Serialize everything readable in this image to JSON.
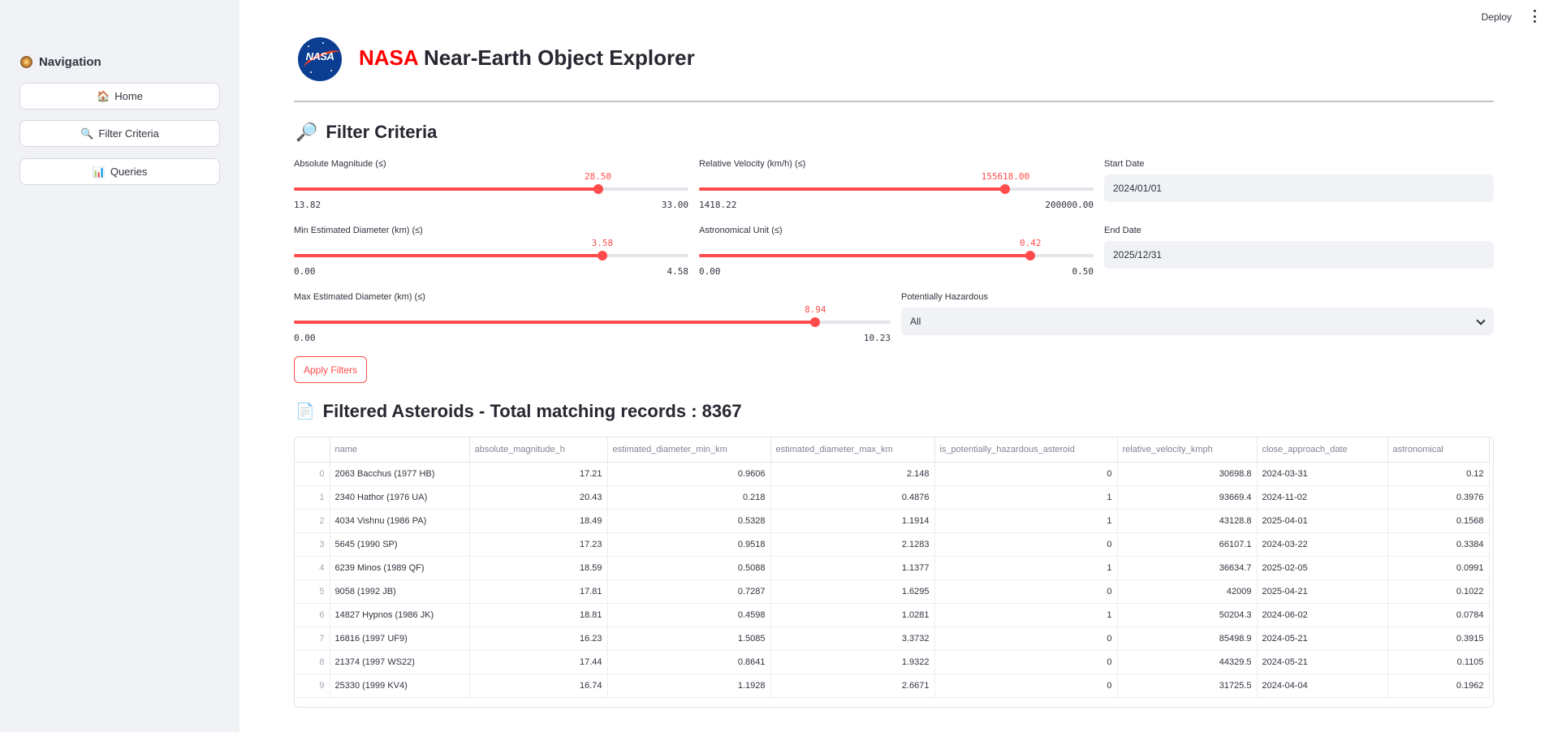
{
  "header": {
    "deploy_label": "Deploy",
    "title_prefix": "NASA",
    "title_rest": " Near-Earth Object Explorer",
    "logo_text": "NASA"
  },
  "sidebar": {
    "title": "Navigation",
    "items": [
      {
        "icon": "🏠",
        "label": "Home"
      },
      {
        "icon": "🔍",
        "label": "Filter Criteria"
      },
      {
        "icon": "📊",
        "label": "Queries"
      }
    ]
  },
  "filters": {
    "heading": "Filter Criteria",
    "heading_icon": "🔎",
    "abs_mag": {
      "label": "Absolute Magnitude (≤)",
      "value": "28.50",
      "min": "13.82",
      "max": "33.00",
      "fraction": 0.7706
    },
    "velocity": {
      "label": "Relative Velocity (km/h) (≤)",
      "value": "155618.00",
      "min": "1418.22",
      "max": "200000.00",
      "fraction": 0.7765
    },
    "min_diam": {
      "label": "Min Estimated Diameter (km) (≤)",
      "value": "3.58",
      "min": "0.00",
      "max": "4.58",
      "fraction": 0.7817
    },
    "au": {
      "label": "Astronomical Unit (≤)",
      "value": "0.42",
      "min": "0.00",
      "max": "0.50",
      "fraction": 0.84
    },
    "max_diam": {
      "label": "Max Estimated Diameter (km) (≤)",
      "value": "8.94",
      "min": "0.00",
      "max": "10.23",
      "fraction": 0.8739
    },
    "start_date": {
      "label": "Start Date",
      "value": "2024/01/01"
    },
    "end_date": {
      "label": "End Date",
      "value": "2025/12/31"
    },
    "hazardous": {
      "label": "Potentially Hazardous",
      "value": "All"
    },
    "apply_label": "Apply Filters"
  },
  "results": {
    "heading_icon": "📄",
    "heading": "Filtered Asteroids - Total matching records : 8367",
    "columns": [
      "",
      "name",
      "absolute_magnitude_h",
      "estimated_diameter_min_km",
      "estimated_diameter_max_km",
      "is_potentially_hazardous_asteroid",
      "relative_velocity_kmph",
      "close_approach_date",
      "astronomical"
    ],
    "rows": [
      [
        "0",
        "2063 Bacchus (1977 HB)",
        "17.21",
        "0.9606",
        "2.148",
        "0",
        "30698.8",
        "2024-03-31",
        "0.12"
      ],
      [
        "1",
        "2340 Hathor (1976 UA)",
        "20.43",
        "0.218",
        "0.4876",
        "1",
        "93669.4",
        "2024-11-02",
        "0.3976"
      ],
      [
        "2",
        "4034 Vishnu (1986 PA)",
        "18.49",
        "0.5328",
        "1.1914",
        "1",
        "43128.8",
        "2025-04-01",
        "0.1568"
      ],
      [
        "3",
        "5645 (1990 SP)",
        "17.23",
        "0.9518",
        "2.1283",
        "0",
        "66107.1",
        "2024-03-22",
        "0.3384"
      ],
      [
        "4",
        "6239 Minos (1989 QF)",
        "18.59",
        "0.5088",
        "1.1377",
        "1",
        "36634.7",
        "2025-02-05",
        "0.0991"
      ],
      [
        "5",
        "9058 (1992 JB)",
        "17.81",
        "0.7287",
        "1.6295",
        "0",
        "42009",
        "2025-04-21",
        "0.1022"
      ],
      [
        "6",
        "14827 Hypnos (1986 JK)",
        "18.81",
        "0.4598",
        "1.0281",
        "1",
        "50204.3",
        "2024-06-02",
        "0.0784"
      ],
      [
        "7",
        "16816 (1997 UF9)",
        "16.23",
        "1.5085",
        "3.3732",
        "0",
        "85498.9",
        "2024-05-21",
        "0.3915"
      ],
      [
        "8",
        "21374 (1997 WS22)",
        "17.44",
        "0.8641",
        "1.9322",
        "0",
        "44329.5",
        "2024-05-21",
        "0.1105"
      ],
      [
        "9",
        "25330 (1999 KV4)",
        "16.74",
        "1.1928",
        "2.6671",
        "0",
        "31725.5",
        "2024-04-04",
        "0.1962"
      ]
    ]
  },
  "colors": {
    "accent": "#ff4b4b",
    "sidebar_bg": "#f0f2f6",
    "nasa_blue": "#0b3d91",
    "nasa_red": "#fc3d21"
  }
}
